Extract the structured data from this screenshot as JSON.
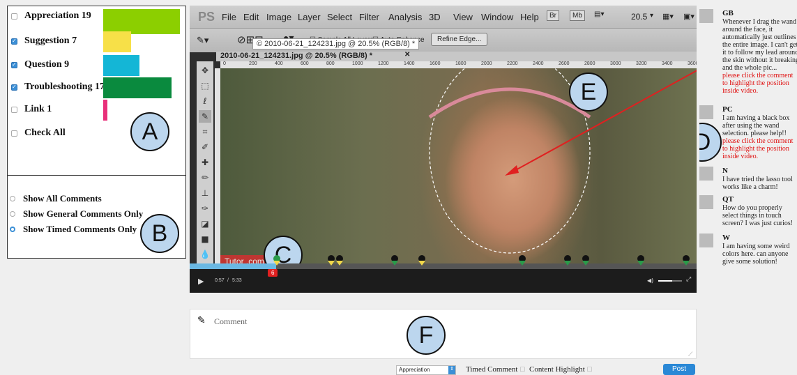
{
  "filters": {
    "items": [
      {
        "label": "Appreciation 19",
        "checked": false,
        "color": "#8ccf00",
        "value": 19
      },
      {
        "label": "Suggestion 7",
        "checked": true,
        "color": "#f7e048",
        "value": 7
      },
      {
        "label": "Question 9",
        "checked": true,
        "color": "#14b6d6",
        "value": 9
      },
      {
        "label": "Troubleshooting 17",
        "checked": true,
        "color": "#0a8a3e",
        "value": 17
      },
      {
        "label": "Link 1",
        "checked": false,
        "color": "#e8307a",
        "value": 1
      },
      {
        "label": "Check All",
        "checked": false
      }
    ],
    "badge": "A"
  },
  "view_options": {
    "items": [
      {
        "label": "Show All Comments",
        "selected": false
      },
      {
        "label": "Show General Comments Only",
        "selected": false
      },
      {
        "label": "Show Timed Comments Only",
        "selected": true
      }
    ],
    "badge": "B"
  },
  "photoshop": {
    "logo": "PS",
    "menu": [
      "File",
      "Edit",
      "Image",
      "Layer",
      "Select",
      "Filter",
      "Analysis",
      "3D",
      "View",
      "Window",
      "Help"
    ],
    "bridge_btn": "Br",
    "minibridge_btn": "Mb",
    "zoom": "20.5",
    "options": {
      "sample_all_layers": "Sample All Layers",
      "auto_enhance": "Auto-Enhance",
      "refine_edge": "Refine Edge..."
    },
    "doc_tab": "2010-06-21_124231.jpg @ 20.5% (RGB/8) *",
    "tooltip": "© 2010-06-21_124231.jpg @ 20.5% (RGB/8) *",
    "ruler_marks": [
      "0",
      "200",
      "400",
      "600",
      "800",
      "1000",
      "1200",
      "1400",
      "1600",
      "1800",
      "2000",
      "2200",
      "2400",
      "2600",
      "2800",
      "3000",
      "3200",
      "3400",
      "3600"
    ],
    "watermark": "Tutor     .com",
    "badges": {
      "c": "C",
      "e": "E"
    }
  },
  "video": {
    "current_time": "0:57",
    "separator": "/",
    "duration": "5:33",
    "progress": 0.17,
    "marker_count": "6",
    "volume": 0.6
  },
  "comments": {
    "badge": "D",
    "items": [
      {
        "name": "GB",
        "text": "Whenever I drag the wand around the face, it automatically just outlines the entire image. I can't get it to follow my lead around the skin without it breaking and the whole pic...",
        "highlight": "please click the comment to highlight the position inside video."
      },
      {
        "name": "PC",
        "text": "I am having a black box after using the wand selection. please help!!",
        "highlight": "please click the comment to highlight the position inside video."
      },
      {
        "name": "N",
        "text": "I have tried the lasso tool works like a charm!",
        "highlight": ""
      },
      {
        "name": "QT",
        "text": "How do you properly select things in touch screen? I was just curios!",
        "highlight": ""
      },
      {
        "name": "W",
        "text": "I am having some weird colors here. can anyone give some solution!",
        "highlight": ""
      }
    ]
  },
  "composer": {
    "placeholder": "Comment",
    "badge": "F",
    "category": "Appreciation",
    "timed_comment": "Timed Comment",
    "content_highlight": "Content Highlight",
    "post": "Post"
  }
}
